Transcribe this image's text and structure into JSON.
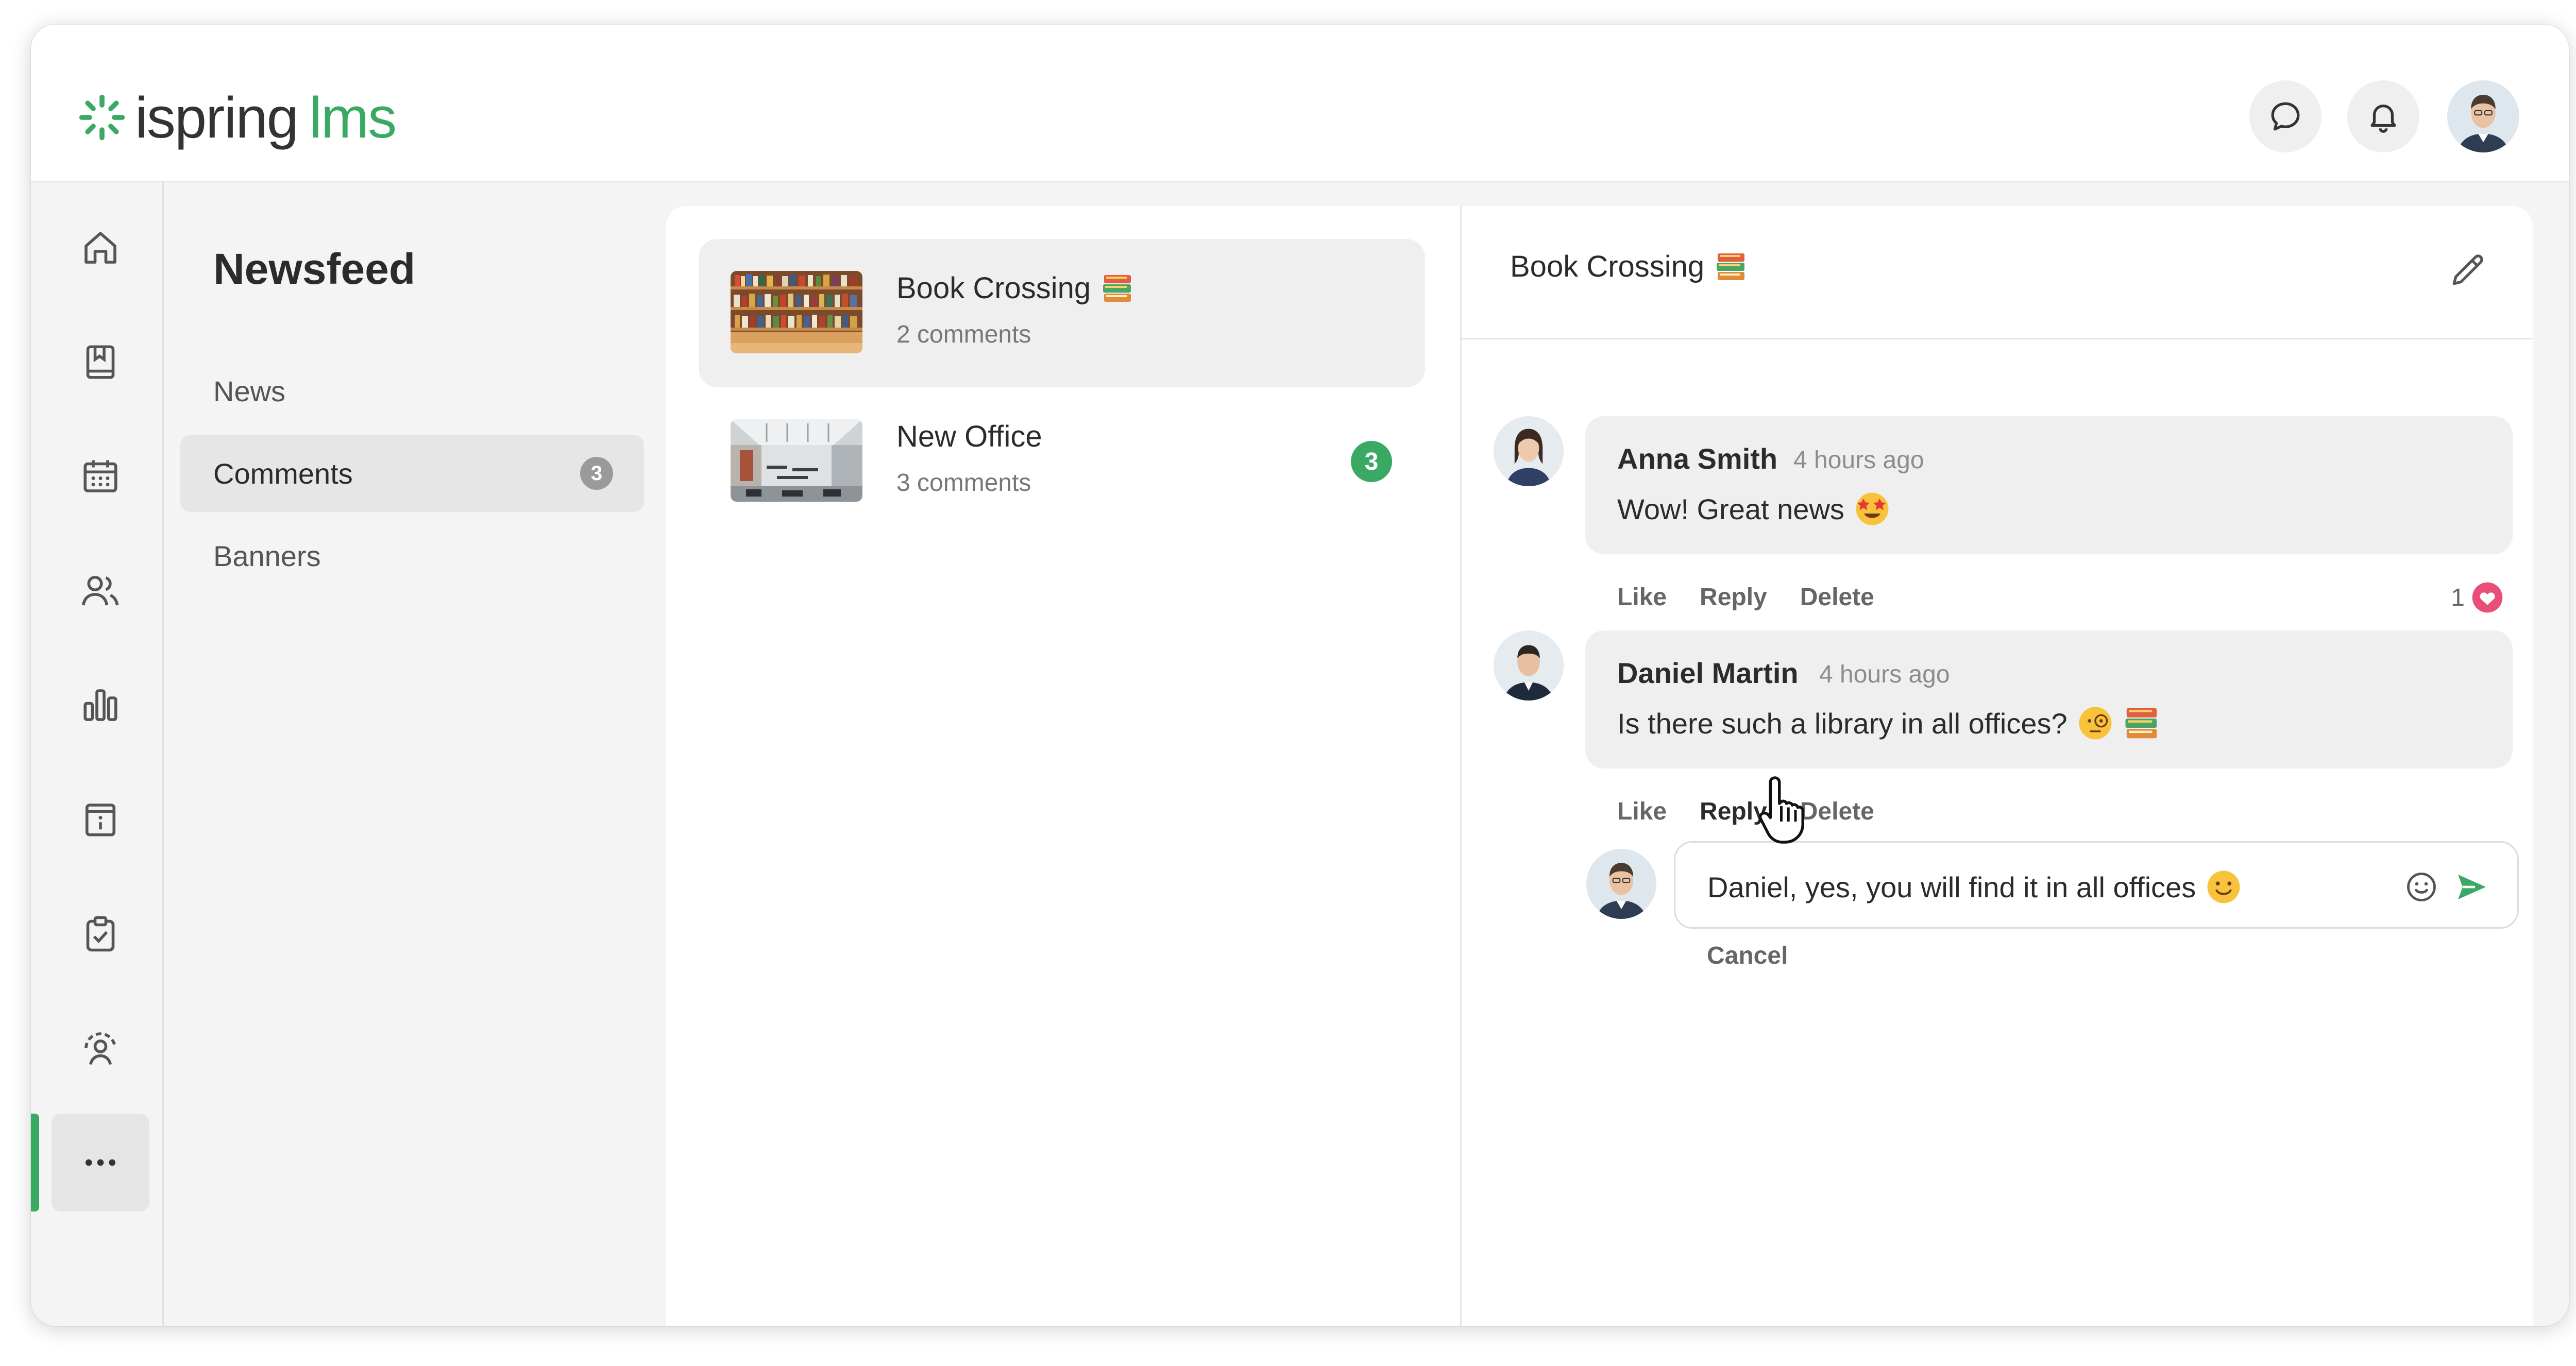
{
  "app": {
    "logo_text": "ispring",
    "logo_product": "lms",
    "accent_color": "#3aa964"
  },
  "header": {
    "icons": [
      "chat-bubble-icon",
      "bell-icon",
      "user-avatar"
    ]
  },
  "rail": {
    "items": [
      "home-icon",
      "book-icon",
      "calendar-icon",
      "users-icon",
      "bar-chart-icon",
      "info-doc-icon",
      "clipboard-check-icon",
      "admin-user-icon",
      "more-dots-icon"
    ],
    "active_item": "more-dots-icon"
  },
  "subnav": {
    "title": "Newsfeed",
    "items": [
      {
        "label": "News"
      },
      {
        "label": "Comments",
        "badge": "3"
      },
      {
        "label": "Banners"
      }
    ],
    "active": "Comments"
  },
  "posts": [
    {
      "title": "Book Crossing",
      "comments": "2 comments",
      "selected": true,
      "badge": ""
    },
    {
      "title": "New Office",
      "comments": "3 comments",
      "selected": false,
      "badge": "3"
    }
  ],
  "detail": {
    "title": "Book Crossing",
    "comments": [
      {
        "author": "Anna Smith",
        "time": "4 hours ago",
        "text": "Wow! Great news",
        "likes": "1"
      },
      {
        "author": "Daniel Martin",
        "time": "4 hours ago",
        "text": "Is there such a library in all offices?"
      }
    ],
    "actions": {
      "like": "Like",
      "reply": "Reply",
      "delete": "Delete"
    },
    "reply": {
      "value": "Daniel, yes, you will find it in all offices",
      "cancel": "Cancel"
    }
  }
}
